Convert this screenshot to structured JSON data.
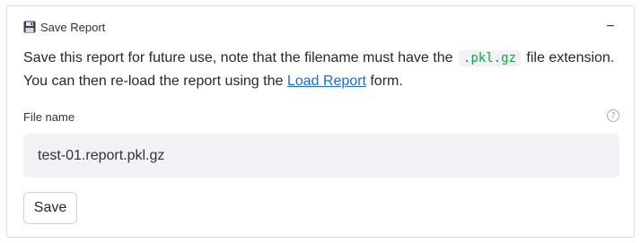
{
  "panel": {
    "icon": "floppy-disk-icon",
    "title": "Save Report",
    "collapse_symbol": "−"
  },
  "description": {
    "part1": "Save this report for future use, note that the filename must have the",
    "code": ".pkl.gz",
    "part2": "file extension. You can then re-load the report using the",
    "link": "Load Report",
    "part3": "form."
  },
  "file_name": {
    "label": "File name",
    "help_icon": "?",
    "value": "test-01.report.pkl.gz"
  },
  "save_button": {
    "label": "Save"
  },
  "colors": {
    "code_text": "#09ab3b",
    "link": "#1c6bdb",
    "input_bg": "#f0f2f6"
  }
}
